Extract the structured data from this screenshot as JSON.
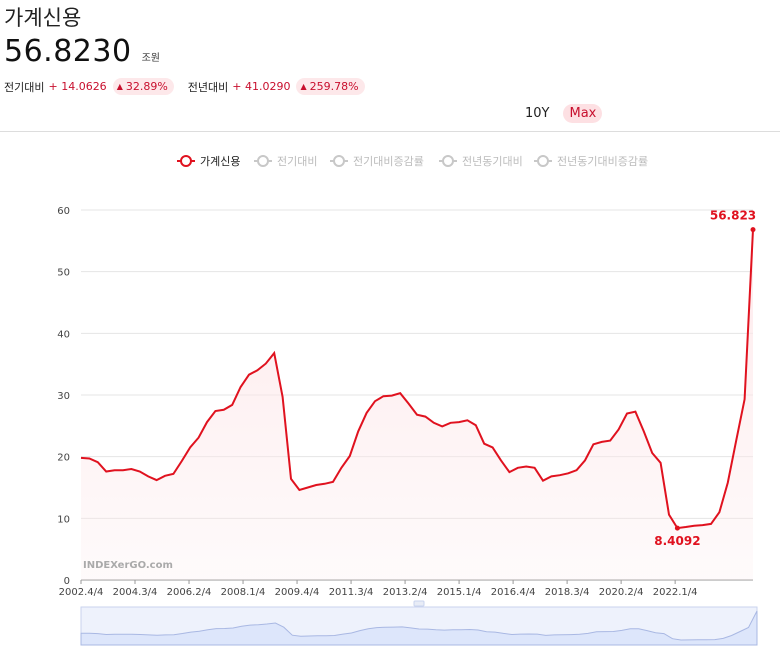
{
  "header": {
    "title": "가계신용",
    "value": "56.8230",
    "unit": "조원",
    "changes": [
      {
        "label": "전기대비",
        "abs": "+ 14.0626",
        "pct": "32.89%"
      },
      {
        "label": "전년대비",
        "abs": "+ 41.0290",
        "pct": "259.78%"
      }
    ]
  },
  "range_buttons": [
    {
      "label": "10Y",
      "active": false
    },
    {
      "label": "Max",
      "active": true
    }
  ],
  "legend": [
    {
      "label": "가계신용",
      "active": true
    },
    {
      "label": "전기대비",
      "active": false
    },
    {
      "label": "전기대비증감률",
      "active": false
    },
    {
      "label": "전년동기대비",
      "active": false
    },
    {
      "label": "전년동기대비증감률",
      "active": false
    }
  ],
  "watermark": "INDEXerGO.com",
  "colors": {
    "accent": "#e0121f",
    "inactive": "#c8c8c8",
    "area": "#fde8ea",
    "navigator": "#dde6fb"
  },
  "chart_data": {
    "type": "line",
    "ylim": [
      0,
      60
    ],
    "y_ticks": [
      0,
      10,
      20,
      30,
      40,
      50,
      60
    ],
    "x_ticks": [
      "2002.4/4",
      "2004.3/4",
      "2006.2/4",
      "2008.1/4",
      "2009.4/4",
      "2011.3/4",
      "2013.2/4",
      "2015.1/4",
      "2016.4/4",
      "2018.3/4",
      "2020.2/4",
      "2022.1/4"
    ],
    "grid": true,
    "series": [
      {
        "name": "가계신용",
        "values": [
          19.8,
          19.7,
          19.1,
          17.6,
          17.8,
          17.8,
          18.0,
          17.6,
          16.8,
          16.2,
          16.9,
          17.2,
          19.3,
          21.5,
          23.1,
          25.6,
          27.4,
          27.6,
          28.4,
          31.3,
          33.3,
          34.0,
          35.1,
          36.8,
          29.7,
          16.4,
          14.6,
          15.0,
          15.4,
          15.6,
          15.9,
          18.2,
          20.1,
          24.1,
          27.1,
          29.0,
          29.8,
          29.9,
          30.3,
          28.6,
          26.8,
          26.5,
          25.5,
          24.9,
          25.5,
          25.6,
          25.9,
          25.1,
          22.1,
          21.5,
          19.4,
          17.5,
          18.2,
          18.4,
          18.2,
          16.1,
          16.8,
          17.0,
          17.3,
          17.8,
          19.4,
          22.0,
          22.4,
          22.6,
          24.4,
          27.0,
          27.3,
          24.1,
          20.6,
          19.0,
          10.6,
          8.4092,
          8.6,
          8.8,
          8.9,
          9.1,
          11.0,
          15.8,
          22.6,
          29.3,
          56.823
        ]
      }
    ],
    "annotations": [
      {
        "label": "56.823",
        "index": 80
      },
      {
        "label": "8.4092",
        "index": 71
      }
    ]
  }
}
